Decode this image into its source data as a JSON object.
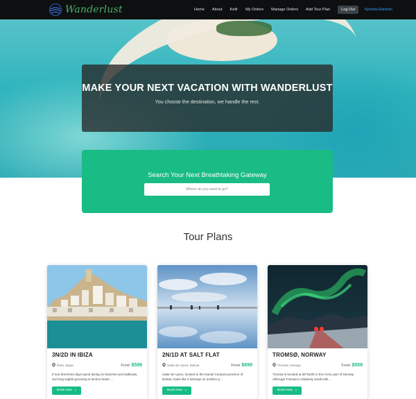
{
  "brand": {
    "name": "Wanderlust",
    "accent": "#4fb06a"
  },
  "nav": {
    "links": [
      "Home",
      "About",
      "Kefir",
      "My Orders",
      "Manage Orders",
      "Add Tour Plan"
    ],
    "logout_label": "Log Out",
    "user_name": "Nyminia Rahman"
  },
  "hero": {
    "title": "MAKE YOUR NEXT VACATION WITH WANDERLUST",
    "subtitle": "You choose the destination, we handle the rest."
  },
  "search": {
    "title": "Search Your Next Breathtaking Gateway",
    "placeholder": "Where do you want to go?",
    "color": "#18bc84"
  },
  "tours": {
    "section_title": "Tour Plans",
    "items": [
      {
        "title": "3N/2D IN IBIZA",
        "location": "Ibiza, Spain",
        "price_prefix": "From",
        "price": "$599",
        "description": "If sun-drenched days spent lazing on beaches and sailboats, and long nights grooving to techno beats ...",
        "button_label": "Book Now"
      },
      {
        "title": "2N/1D AT SALT FLAT",
        "location": "Salar de Uyuni, Bolivia",
        "price_prefix": "From",
        "price": "$699",
        "description": "Salar de Uyuni, located in the Daniel Campos province of Bolivia, looks like it belongs on another p...",
        "button_label": "Book Now"
      },
      {
        "title": "TROMSØ, NORWAY",
        "location": "Tromsø, Norway",
        "price_prefix": "From",
        "price": "$559",
        "description": "Tromsø is located at 69°North in the Arctic part of Norway. Although Tromsø is relatively small with ...",
        "button_label": "Book Now"
      }
    ]
  },
  "icons": {
    "logo": "globe-logo-icon",
    "location": "map-pin-icon",
    "book_chevron": "chevron-right-icon"
  }
}
